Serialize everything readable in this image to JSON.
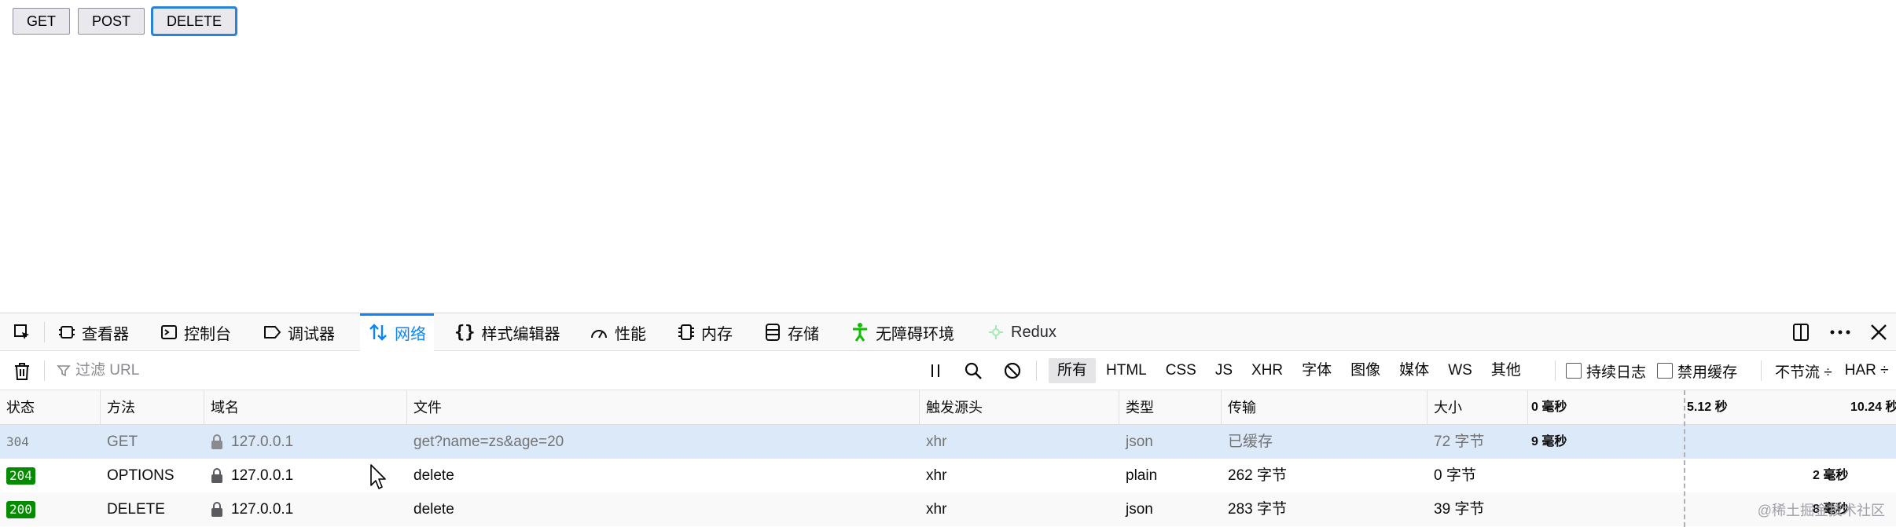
{
  "page": {
    "buttons": [
      "GET",
      "POST",
      "DELETE"
    ]
  },
  "devtools": {
    "tabs": [
      {
        "label": "查看器",
        "icon": "inspector-icon"
      },
      {
        "label": "控制台",
        "icon": "console-icon"
      },
      {
        "label": "调试器",
        "icon": "debugger-icon"
      },
      {
        "label": "网络",
        "icon": "network-icon"
      },
      {
        "label": "样式编辑器",
        "icon": "style-editor-icon"
      },
      {
        "label": "性能",
        "icon": "performance-icon"
      },
      {
        "label": "内存",
        "icon": "memory-icon"
      },
      {
        "label": "存储",
        "icon": "storage-icon"
      },
      {
        "label": "无障碍环境",
        "icon": "accessibility-icon"
      },
      {
        "label": "Redux",
        "icon": "redux-icon"
      }
    ],
    "selected_tab": "网络",
    "filter": {
      "placeholder": "过滤 URL",
      "types": [
        "所有",
        "HTML",
        "CSS",
        "JS",
        "XHR",
        "字体",
        "图像",
        "媒体",
        "WS",
        "其他"
      ],
      "selected_type": "所有",
      "persist_logs": "持续日志",
      "disable_cache": "禁用缓存",
      "throttle": "不节流 ÷",
      "har": "HAR ÷"
    },
    "columns": {
      "status": "状态",
      "method": "方法",
      "domain": "域名",
      "file": "文件",
      "cause": "触发源头",
      "type": "类型",
      "transferred": "传输",
      "size": "大小"
    },
    "waterfall_ticks": [
      "0 毫秒",
      "5.12 秒",
      "10.24 秒"
    ],
    "requests": [
      {
        "status": "304",
        "method": "GET",
        "domain": "127.0.0.1",
        "file": "get?name=zs&age=20",
        "cause": "xhr",
        "type": "json",
        "transferred": "已缓存",
        "size": "72 字节",
        "timing": "9 毫秒"
      },
      {
        "status": "204",
        "method": "OPTIONS",
        "domain": "127.0.0.1",
        "file": "delete",
        "cause": "xhr",
        "type": "plain",
        "transferred": "262 字节",
        "size": "0 字节",
        "timing": "2 毫秒"
      },
      {
        "status": "200",
        "method": "DELETE",
        "domain": "127.0.0.1",
        "file": "delete",
        "cause": "xhr",
        "type": "json",
        "transferred": "283 字节",
        "size": "39 字节",
        "timing": "8 毫秒"
      }
    ]
  },
  "watermark": "@稀土掘金技术社区",
  "colors": {
    "accent": "#0a84ff",
    "status_ok": "#058b00",
    "selected_row": "#dbe9f9"
  }
}
